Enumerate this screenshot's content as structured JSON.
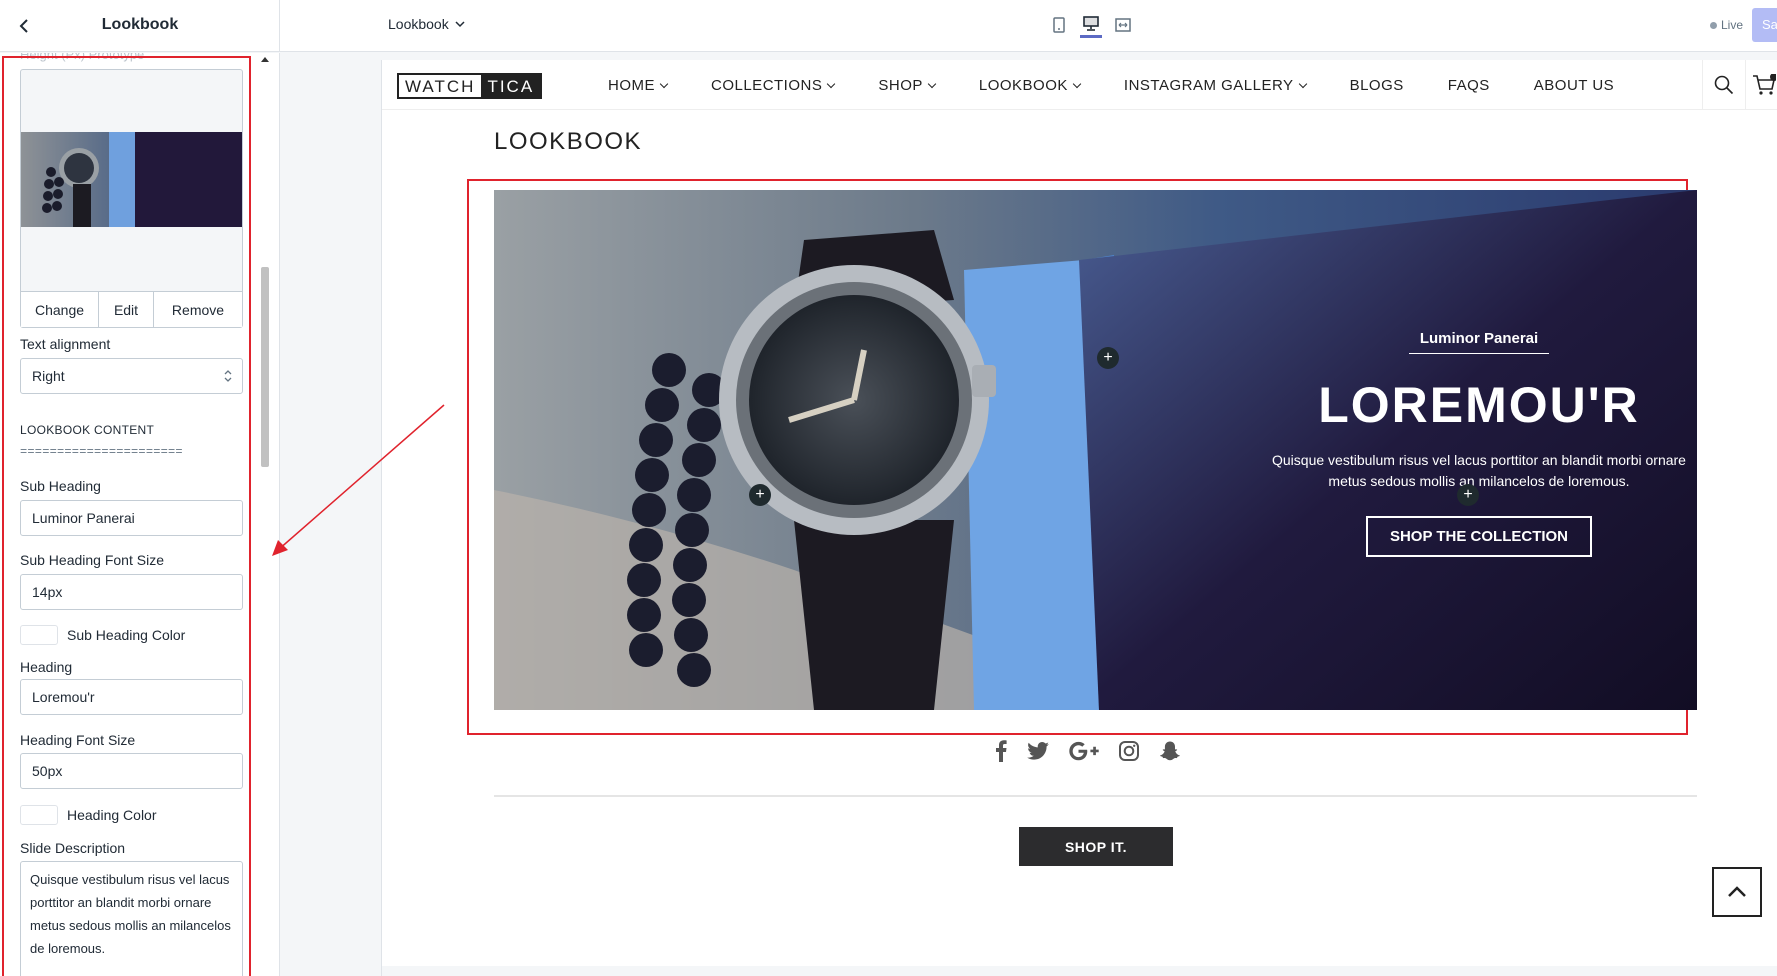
{
  "topbar": {
    "sidebar_title": "Lookbook",
    "template": "Lookbook",
    "live": "Live",
    "save": "Sa"
  },
  "sidebar": {
    "image_field_label": "Height (Px) Prototype",
    "image_actions": [
      "Change",
      "Edit",
      "Remove"
    ],
    "text_alignment_label": "Text alignment",
    "text_alignment_value": "Right",
    "section_heading": "LOOKBOOK CONTENT",
    "section_rule": "======================",
    "sub_heading_label": "Sub Heading",
    "sub_heading_value": "Luminor Panerai",
    "sub_heading_size_label": "Sub Heading Font Size",
    "sub_heading_size_value": "14px",
    "sub_heading_color_label": "Sub Heading Color",
    "heading_label": "Heading",
    "heading_value": "Loremou'r",
    "heading_size_label": "Heading Font Size",
    "heading_size_value": "50px",
    "heading_color_label": "Heading Color",
    "slide_desc_label": "Slide Description",
    "slide_desc_value": "Quisque vestibulum risus vel lacus porttitor an blandit morbi ornare metus sedous mollis an milancelos de loremous."
  },
  "preview": {
    "logo_part1": "WATCH",
    "logo_part2": "TICA",
    "nav": [
      {
        "label": "HOME",
        "dropdown": true
      },
      {
        "label": "COLLECTIONS",
        "dropdown": true
      },
      {
        "label": "SHOP",
        "dropdown": true
      },
      {
        "label": "LOOKBOOK",
        "dropdown": true
      },
      {
        "label": "INSTAGRAM GALLERY",
        "dropdown": true
      },
      {
        "label": "BLOGS",
        "dropdown": false
      },
      {
        "label": "FAQS",
        "dropdown": false
      },
      {
        "label": "ABOUT US",
        "dropdown": false
      }
    ],
    "page_title": "LOOKBOOK",
    "banner": {
      "sub_heading": "Luminor Panerai",
      "heading": "LOREMOU'R",
      "description": "Quisque vestibulum risus vel lacus porttitor an blandit morbi ornare metus sedous mollis an milancelos de loremous.",
      "button": "SHOP THE COLLECTION"
    },
    "social_icons": [
      "facebook-icon",
      "twitter-icon",
      "google-plus-icon",
      "instagram-icon",
      "snapchat-icon"
    ],
    "shop_it": "SHOP IT."
  },
  "colors": {
    "highlight_red": "#e0232d",
    "accent": "#5c6ac4",
    "dark_button": "#2c2c2e"
  }
}
